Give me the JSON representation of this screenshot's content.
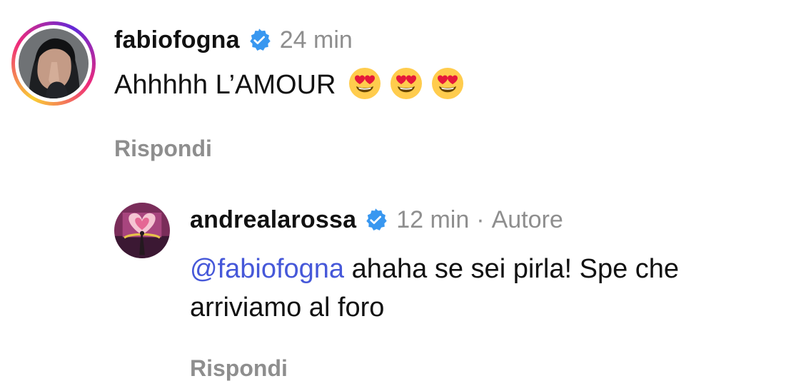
{
  "comments": [
    {
      "username": "fabiofogna",
      "time": "24 min",
      "text": "Ahhhhh L’AMOUR",
      "emojis": [
        "smiling-face-with-heart-eyes",
        "smiling-face-with-heart-eyes",
        "smiling-face-with-heart-eyes"
      ],
      "reply_label": "Rispondi"
    },
    {
      "username": "andrealarossa",
      "time": "12 min",
      "separator": "·",
      "author_label": "Autore",
      "mention": "@fabiofogna",
      "text": " ahaha se sei pirla! Spe che arriviamo al foro",
      "reply_label": "Rispondi"
    }
  ],
  "icons": {
    "verified": "verified-badge-icon",
    "emoji": "heart-eyes-emoji-icon"
  },
  "colors": {
    "verified_blue": "#3897f0",
    "mention_blue": "#4658d9",
    "muted_gray": "#8e8e8e",
    "story_ring_start": "#f9ce34",
    "story_ring_mid": "#ee2a7b",
    "story_ring_end": "#6228d7"
  }
}
